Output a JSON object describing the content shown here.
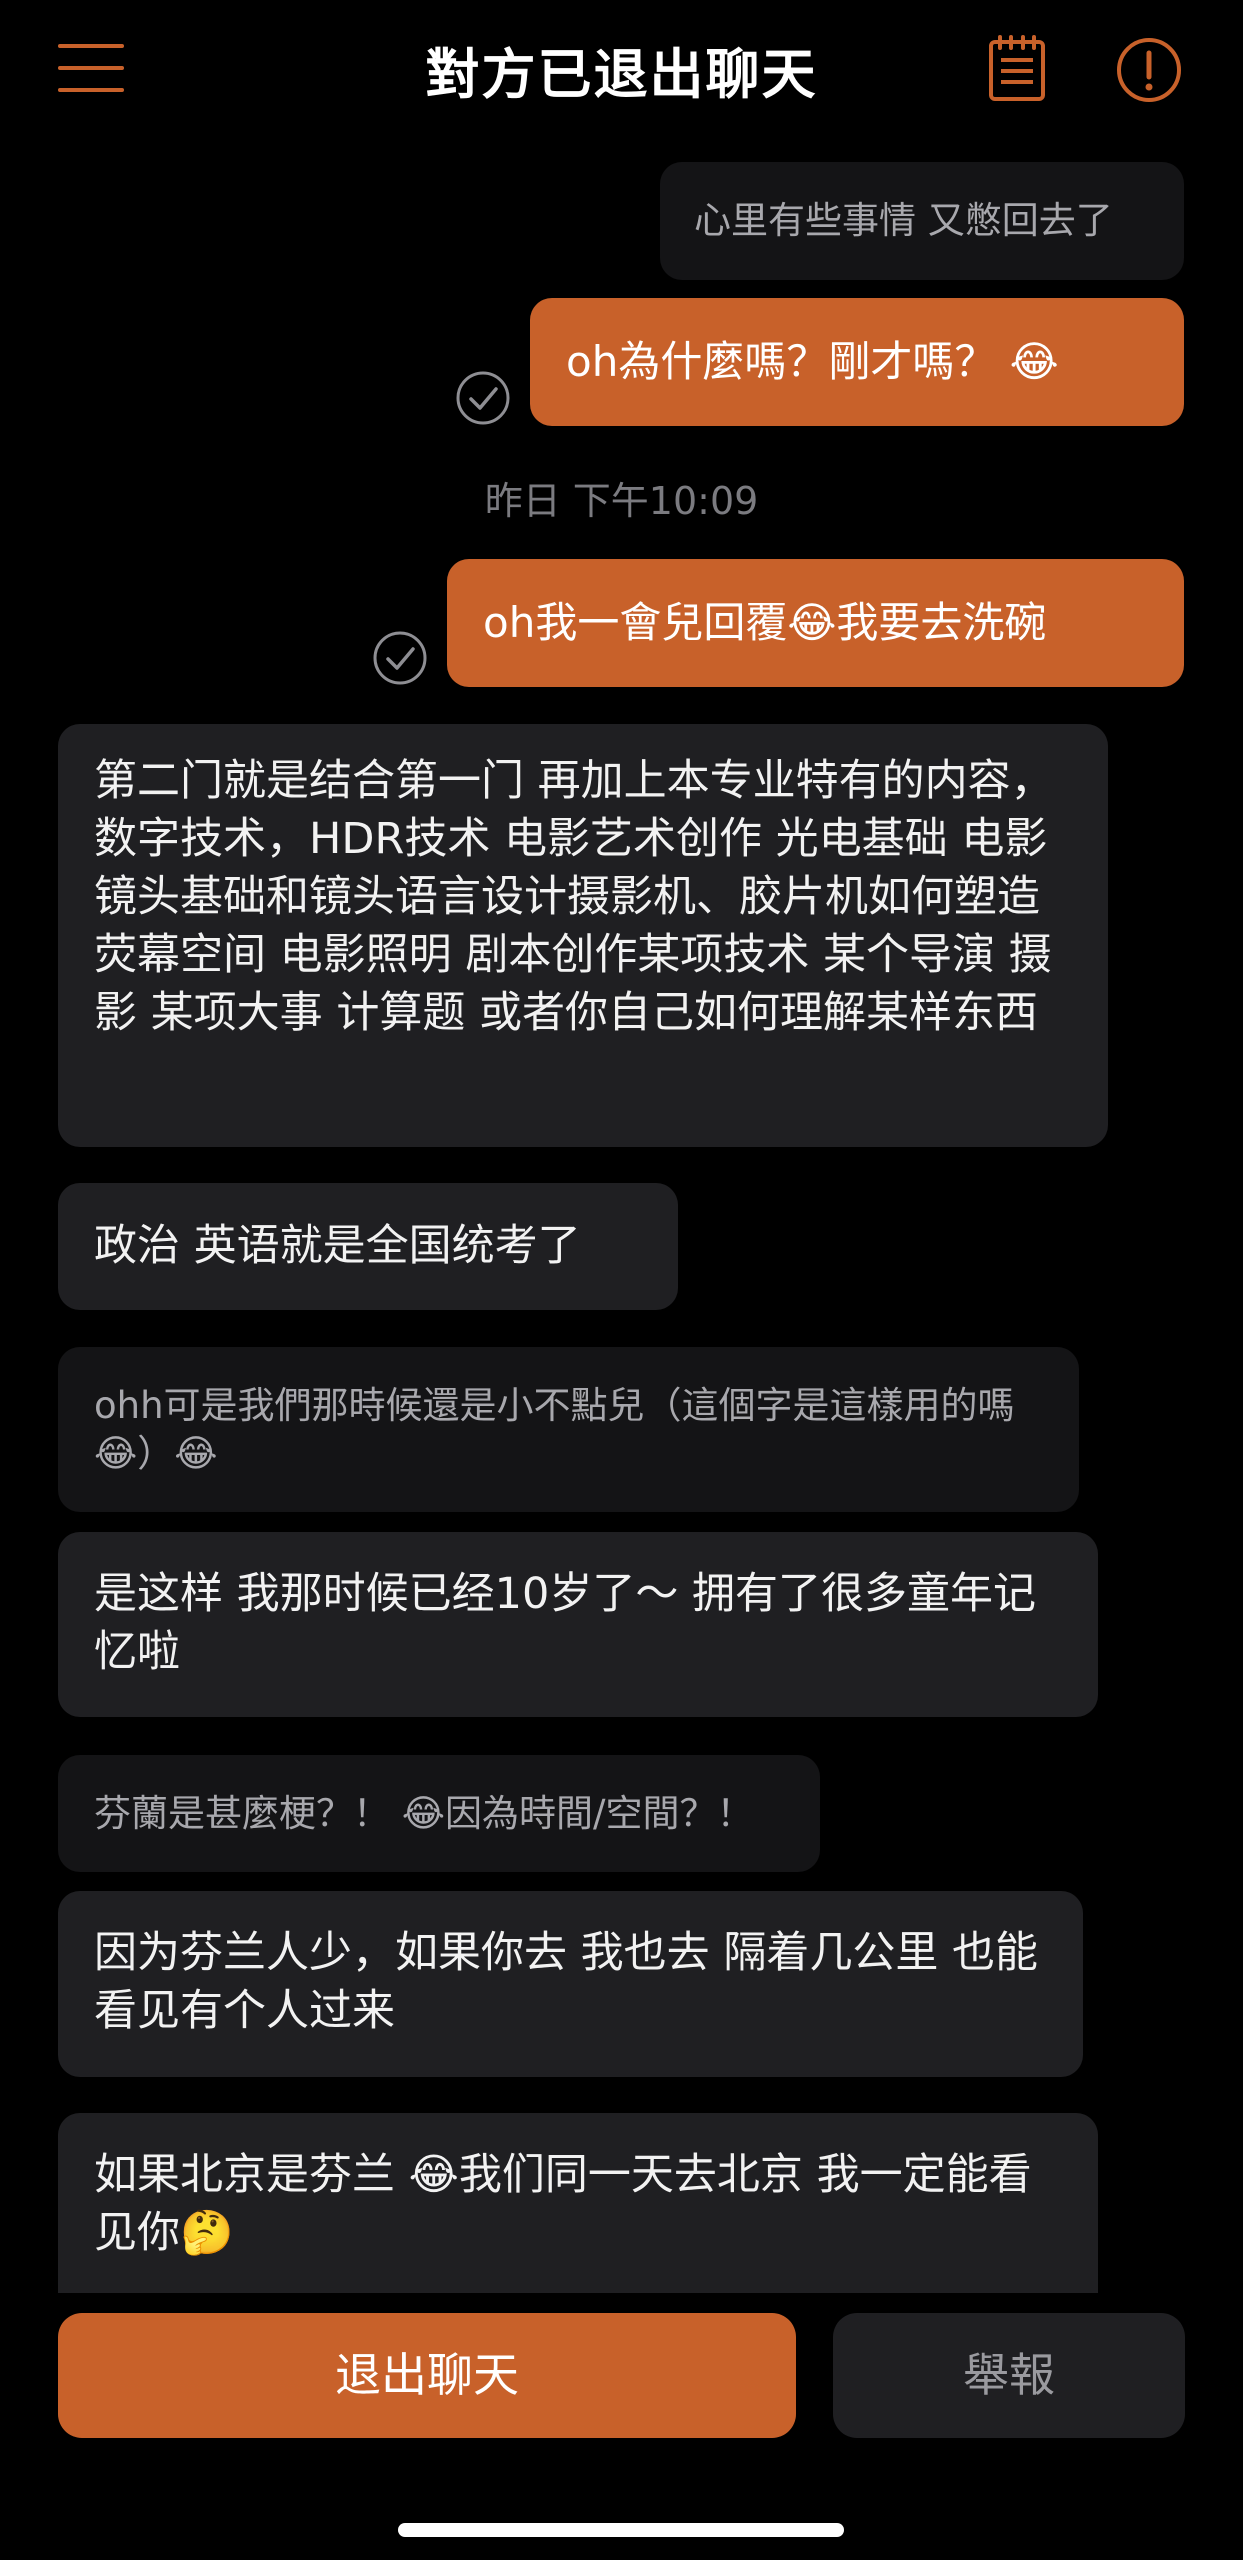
{
  "header": {
    "title": "對方已退出聊天",
    "menu_icon": "hamburger-menu-icon",
    "notes_icon": "notepad-icon",
    "alert_icon": "exclamation-circle-icon"
  },
  "colors": {
    "background": "#000000",
    "accent": "#c8612a",
    "bubble_dark": "#1f1f22",
    "bubble_system": "#141416",
    "text_muted": "#a8a8ad"
  },
  "messages": [
    {
      "sender": "system",
      "text": "心里有些事情 又憋回去了"
    },
    {
      "sender": "me",
      "text": "oh為什麼嗎？剛才嗎？ 😂",
      "status": "sent"
    },
    {
      "sender": "timestamp",
      "text": "昨日 下午10:09"
    },
    {
      "sender": "me",
      "text": "oh我一會兒回覆😂我要去洗碗",
      "status": "sent"
    },
    {
      "sender": "other",
      "text": "第二门就是结合第一门 再加上本专业特有的内容，数字技术，HDR技术 电影艺术创作 光电基础  电影镜头基础和镜头语言设计摄影机、胶片机如何塑造荧幕空间  电影照明 剧本创作某项技术 某个导演 摄影 某项大事 计算题 或者你自己如何理解某样东西"
    },
    {
      "sender": "other",
      "text": "政治 英语就是全国统考了"
    },
    {
      "sender": "system",
      "text": "ohh可是我們那時候還是小不點兒（這個字是這樣用的嗎😂）😂"
    },
    {
      "sender": "other",
      "text": "是这样 我那时候已经10岁了～ 拥有了很多童年记忆啦"
    },
    {
      "sender": "system",
      "text": "芬蘭是甚麼梗？！ 😂因為時間/空間？！"
    },
    {
      "sender": "other",
      "text": "因为芬兰人少，如果你去 我也去 隔着几公里 也能看见有个人过来"
    },
    {
      "sender": "other",
      "text": "如果北京是芬兰 😂我们同一天去北京 我一定能看见你🤔"
    }
  ],
  "footer": {
    "exit_label": "退出聊天",
    "report_label": "舉報"
  }
}
